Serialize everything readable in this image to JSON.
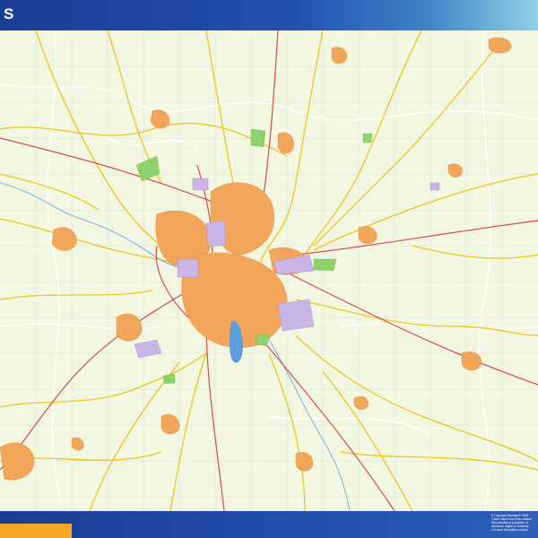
{
  "header": {
    "title": "S"
  },
  "footer": {
    "copyright_lines": [
      "© Copyright Netmaps® 1988 -",
      "These maps have been created",
      "Reproduction is prohibited, in",
      "electronic, digital or mechanic",
      "For more information consult"
    ]
  },
  "colors": {
    "header": "#2250b0",
    "footer": "#2250b0",
    "accent": "#f5a623",
    "map_background": "#f3f6e0",
    "urban": "#f2a65a",
    "industrial": "#c9b6e6",
    "park": "#8fd16a",
    "water": "#5aa0e0",
    "major_road": "#d94a4a",
    "secondary_road": "#f0c419"
  }
}
